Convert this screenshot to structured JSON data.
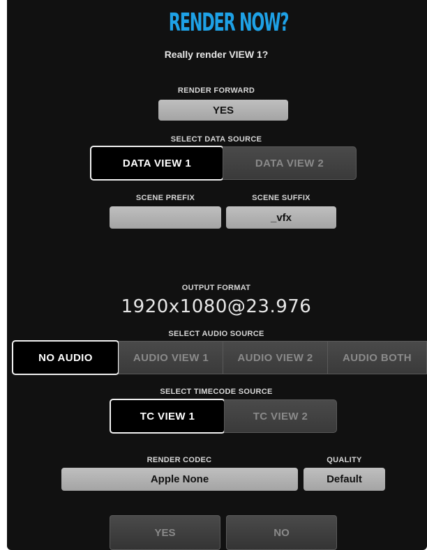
{
  "dialog": {
    "title": "RENDER NOW?",
    "subtitle": "Really render VIEW 1?"
  },
  "render_forward": {
    "label": "RENDER FORWARD",
    "value": "YES"
  },
  "data_source": {
    "label": "SELECT DATA SOURCE",
    "options": [
      "DATA VIEW 1",
      "DATA VIEW 2"
    ],
    "selected": "DATA VIEW 1"
  },
  "scene": {
    "prefix_label": "SCENE PREFIX",
    "prefix_value": "",
    "suffix_label": "SCENE SUFFIX",
    "suffix_value": "_vfx"
  },
  "output_format": {
    "label": "OUTPUT FORMAT",
    "value": "1920x1080@23.976"
  },
  "audio_source": {
    "label": "SELECT AUDIO SOURCE",
    "options": [
      "NO AUDIO",
      "AUDIO VIEW 1",
      "AUDIO VIEW 2",
      "AUDIO BOTH"
    ],
    "selected": "NO AUDIO"
  },
  "timecode_source": {
    "label": "SELECT TIMECODE SOURCE",
    "options": [
      "TC VIEW 1",
      "TC VIEW 2"
    ],
    "selected": "TC VIEW 1"
  },
  "codec": {
    "label": "RENDER CODEC",
    "value": "Apple None"
  },
  "quality": {
    "label": "QUALITY",
    "value": "Default"
  },
  "actions": {
    "yes": "YES",
    "no": "NO"
  },
  "colors": {
    "accent": "#1ea1e6",
    "background": "#111111",
    "field": "#b0b0b0"
  }
}
